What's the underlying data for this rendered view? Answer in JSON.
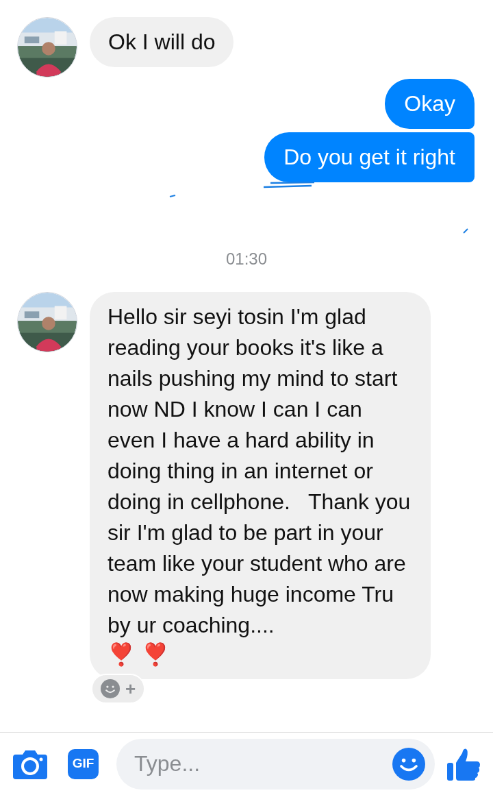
{
  "messages": [
    {
      "kind": "received",
      "text": "Ok I will do",
      "avatar": true
    },
    {
      "kind": "sent",
      "text": "Okay"
    },
    {
      "kind": "sent",
      "text": "Do you get it right",
      "scribble": true
    },
    {
      "kind": "timestamp",
      "text": "01:30"
    },
    {
      "kind": "received",
      "text": "Hello sir seyi tosin I'm glad reading your books it's like a nails pushing my mind to start now ND I know I can I can even I have a hard ability in doing thing in an internet or doing in cellphone.   Thank you sir I'm glad to be part in your team like your student who are now making huge income Tru by ur coaching....",
      "emoji": "❣️ ❣️",
      "avatar": true,
      "reaction_button": {
        "label": "+"
      }
    }
  ],
  "composer": {
    "gif_label": "GIF",
    "placeholder": "Type..."
  }
}
